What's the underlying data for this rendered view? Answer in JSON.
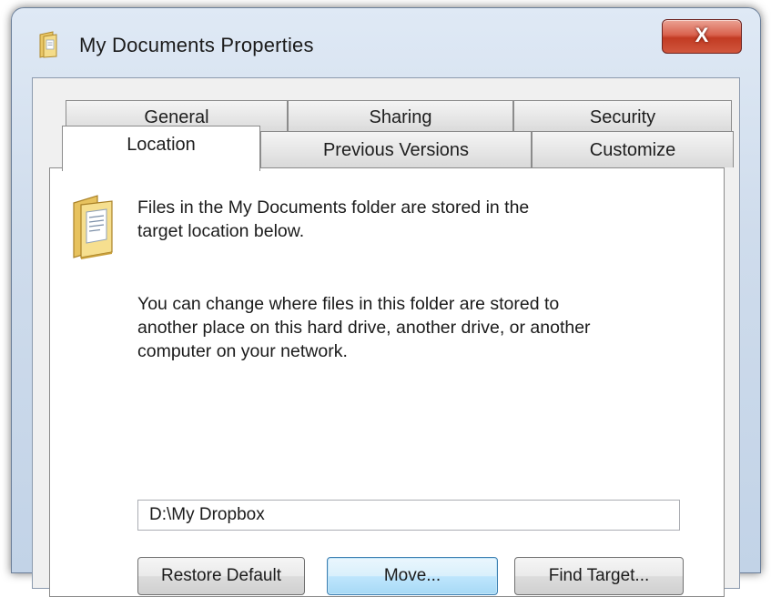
{
  "window": {
    "title": "My Documents Properties",
    "close_label": "X",
    "title_icon": "folder-icon"
  },
  "tabs": {
    "row1": [
      {
        "label": "General"
      },
      {
        "label": "Sharing"
      },
      {
        "label": "Security"
      }
    ],
    "row2": [
      {
        "label": "Location",
        "active": true
      },
      {
        "label": "Previous Versions"
      },
      {
        "label": "Customize"
      }
    ]
  },
  "location_tab": {
    "icon": "documents-folder-icon",
    "intro_line1": "Files in the My Documents folder are stored in the",
    "intro_line2": "target location below.",
    "desc_line1": "You can change where files in this folder are stored to",
    "desc_line2": "another place on this hard drive, another drive, or another",
    "desc_line3": "computer on your network.",
    "path_value": "D:\\My Dropbox",
    "buttons": {
      "restore_default": "Restore Default",
      "move": "Move...",
      "find_target": "Find Target..."
    }
  },
  "colors": {
    "close_button": "#c23b23",
    "default_button_border": "#3c7fb1",
    "window_frame": "#cfdcec"
  }
}
